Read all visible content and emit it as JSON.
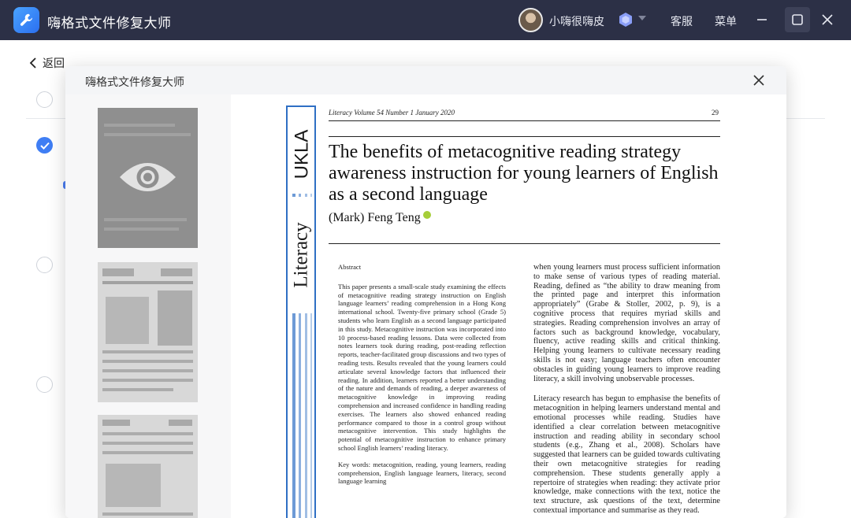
{
  "app": {
    "title": "嗨格式文件修复大师",
    "user_name": "小嗨很嗨皮",
    "service_label": "客服",
    "menu_label": "菜单",
    "icons": [
      "wrench-app-icon",
      "vip-diamond-icon",
      "minimize-icon",
      "maximize-icon",
      "close-icon"
    ]
  },
  "main": {
    "back_label": "返回"
  },
  "modal": {
    "title": "嗨格式文件修复大师",
    "close_icon": "close-icon",
    "thumbnails": [
      {
        "state": "selected",
        "icon": "eye-icon"
      },
      {
        "state": "normal"
      },
      {
        "state": "normal"
      }
    ]
  },
  "document": {
    "sidebar_brand": "UKLA",
    "sidebar_journal": "Literacy",
    "running_head": "Literacy   Volume 54   Number 1   January 2020",
    "page_number": "29",
    "title": "The benefits of metacognitive reading strategy awareness instruction for young learners of English as a second language",
    "author": "(Mark) Feng Teng",
    "abstract_heading": "Abstract",
    "abstract_text": "This paper presents a small-scale study examining the effects of metacognitive reading strategy instruction on English language learners’ reading comprehension in a Hong Kong international school. Twenty-five primary school (Grade 5) students who learn English as a second language participated in this study. Metacognitive instruction was incorporated into 10 process-based reading lessons. Data were collected from notes learners took during reading, post-reading reflection reports, teacher-facilitated group discussions and two types of reading tests. Results revealed that the young learners could articulate several knowledge factors that influenced their reading. In addition, learners reported a better understanding of the nature and demands of reading, a deeper awareness of metacognitive knowledge in improving reading comprehension and increased confidence in handling reading exercises. The learners also showed enhanced reading performance compared to those in a control group without metacognitive intervention. This study highlights the potential of metacognitive instruction to enhance primary school English learners’ reading literacy.",
    "keywords": "Key words: metacognition, reading, young learners, reading comprehension, English language learners, literacy, second language learning",
    "right_para_1": "when young learners must process sufficient information to make sense of various types of reading material. Reading, defined as “the ability to draw meaning from the printed page and interpret this information appropriately” (Grabe & Stoller, 2002, p. 9), is a cognitive process that requires myriad skills and strategies. Reading comprehension involves an array of factors such as background knowledge, vocabulary, fluency, active reading skills and critical thinking. Helping young learners to cultivate necessary reading skills is not easy; language teachers often encounter obstacles in guiding young learners to improve reading literacy, a skill involving unobservable processes.",
    "right_para_2": "Literacy research has begun to emphasise the benefits of metacognition in helping learners understand mental and emotional processes while reading. Studies have identified a clear correlation between metacognitive instruction and reading ability in secondary school students (e.g., Zhang et al., 2008). Scholars have suggested that learners can be guided towards cultivating their own metacognitive strategies for reading comprehension. These students generally apply a repertoire of strategies when reading: they activate prior knowledge, make connections with the text, notice the text structure, ask questions of the text, determine contextual importance and summarise as they read."
  },
  "colors": {
    "titlebar": "#2c3046",
    "accent": "#3f7ef4",
    "journal_blue": "#2f6fc4"
  }
}
